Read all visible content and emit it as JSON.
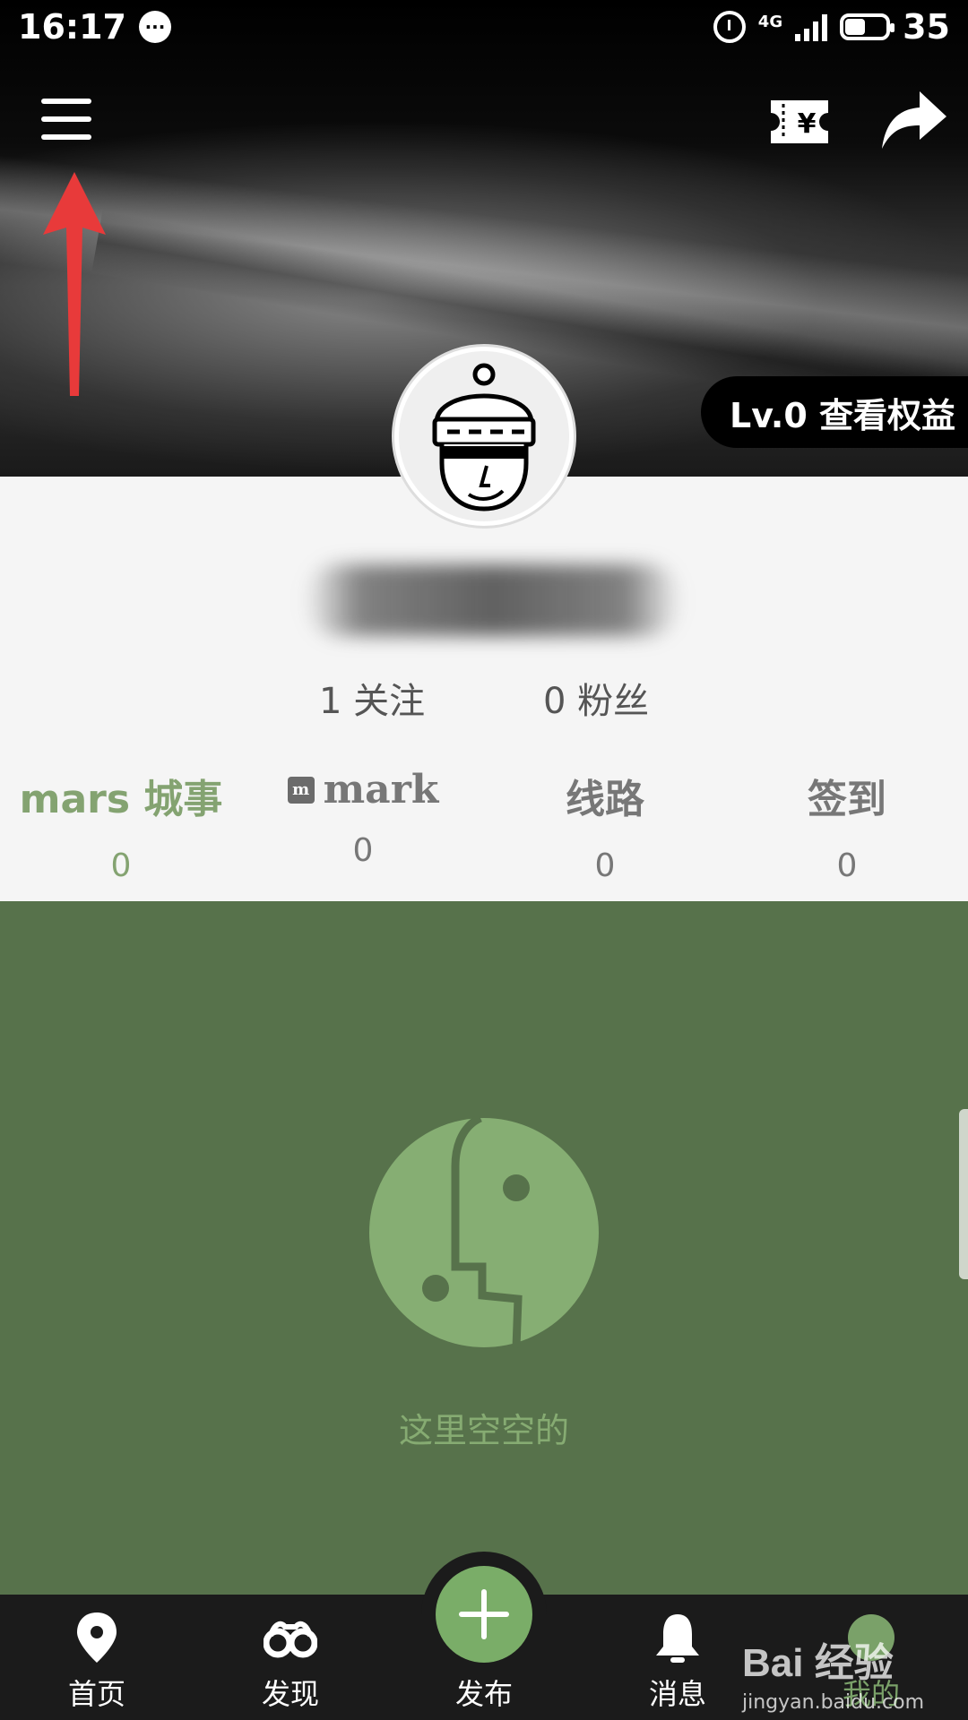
{
  "status_bar": {
    "time": "16:17",
    "network": "4G",
    "battery": "35"
  },
  "profile": {
    "level_badge": "Lv.0 查看权益",
    "following": "1 关注",
    "followers": "0 粉丝"
  },
  "stats": [
    {
      "label": "mars 城事",
      "value": "0"
    },
    {
      "label": "mark",
      "value": "0"
    },
    {
      "label": "线路",
      "value": "0"
    },
    {
      "label": "签到",
      "value": "0"
    }
  ],
  "empty_state": {
    "text": "这里空空的"
  },
  "bottom_nav": {
    "home": "首页",
    "discover": "发现",
    "publish": "发布",
    "messages": "消息",
    "mine": "我的"
  },
  "watermark": {
    "logo": "Bai 经验",
    "site": "jingyan.baidu.com"
  },
  "colors": {
    "accent_green": "#84a371",
    "content_bg": "#57724b",
    "nav_bg": "#1b1b1b",
    "annotation_red": "#e83a3a"
  }
}
